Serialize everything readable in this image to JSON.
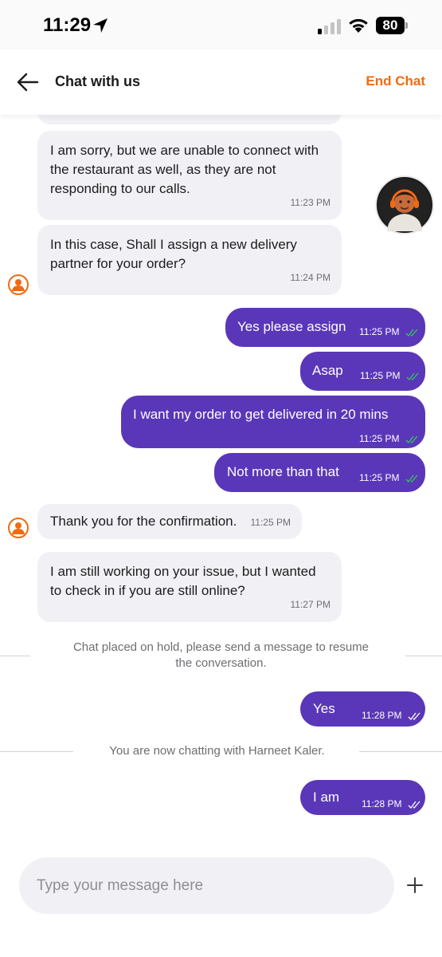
{
  "status_bar": {
    "time": "11:29",
    "battery": "80"
  },
  "header": {
    "title": "Chat with us",
    "end_chat": "End Chat"
  },
  "messages": [
    {
      "text": "I am sorry, but we are unable to connect with the restaurant as well, as they are not responding to our calls.",
      "time": "11:23 PM"
    },
    {
      "text": "In this case, Shall I assign a new delivery partner for your order?",
      "time": "11:24 PM"
    },
    {
      "text": "Yes please assign",
      "time": "11:25 PM"
    },
    {
      "text": "Asap",
      "time": "11:25 PM"
    },
    {
      "text": "I want my order to get delivered in 20 mins",
      "time": "11:25 PM"
    },
    {
      "text": "Not more than that",
      "time": "11:25 PM"
    },
    {
      "text": "Thank you for the confirmation.",
      "time": "11:25 PM"
    },
    {
      "text": "I am still working on your issue, but I wanted to check in if you are still online?",
      "time": "11:27 PM"
    },
    {
      "text": "Yes",
      "time": "11:28 PM"
    },
    {
      "text": "I am",
      "time": "11:28 PM"
    }
  ],
  "system": {
    "hold": "Chat placed on hold, please send a message to resume the conversation.",
    "agent_joined": "You are now chatting with Harneet Kaler."
  },
  "composer": {
    "placeholder": "Type your message here"
  },
  "colors": {
    "accent": "#f26a10",
    "outgoing_bubble": "#5a37b8",
    "incoming_bubble": "#f1f1f5",
    "read_tick": "#34c759"
  },
  "icons": [
    "location-arrow-icon",
    "signal-icon",
    "wifi-icon",
    "battery-icon",
    "back-arrow-icon",
    "agent-avatar-icon",
    "double-check-icon",
    "plus-icon"
  ]
}
